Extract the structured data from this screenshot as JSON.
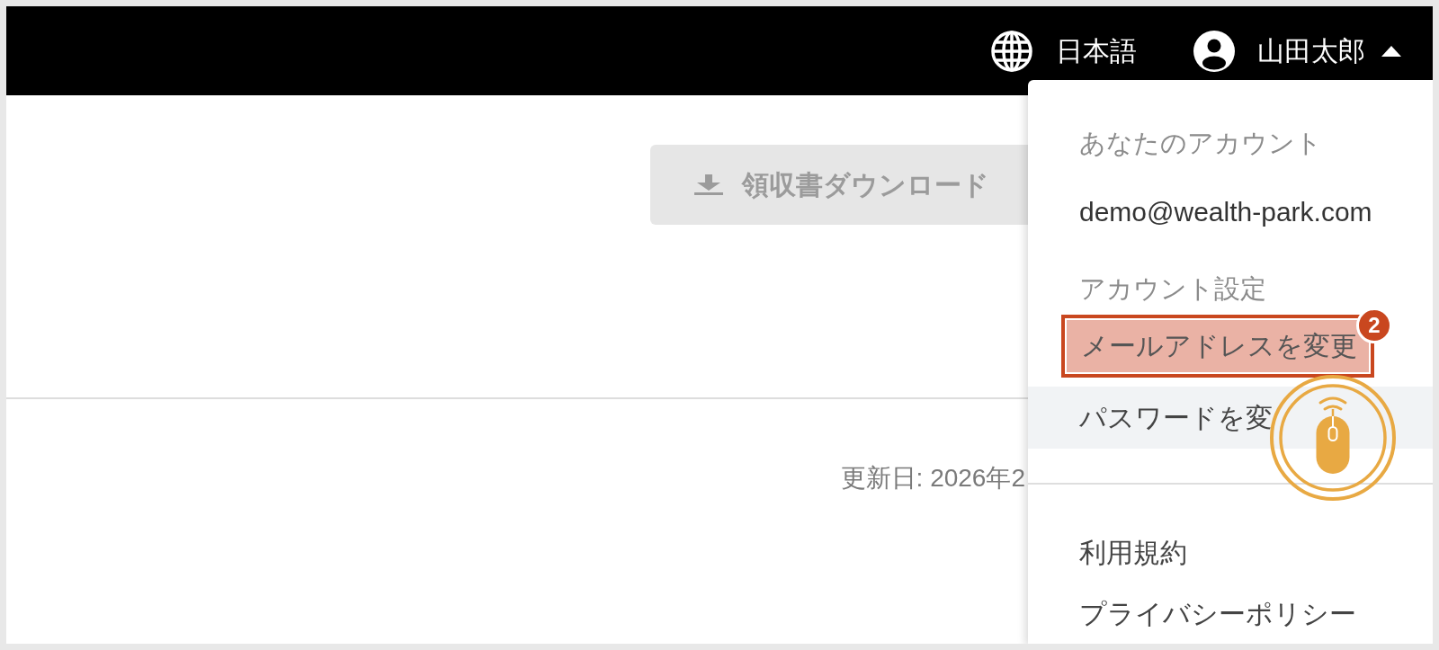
{
  "top_bar": {
    "language": "日本語",
    "user_name": "山田太郎",
    "menu_expanded": true
  },
  "main": {
    "download_button": "領収書ダウンロード",
    "updated_date": "更新日: 2026年2"
  },
  "account_menu": {
    "items": [
      {
        "kind": "heading",
        "label": "あなたのアカウント"
      },
      {
        "kind": "text",
        "label": "demo@wealth-park.com"
      },
      {
        "kind": "heading",
        "label": "アカウント設定"
      },
      {
        "kind": "link",
        "label": "メールアドレスを変更",
        "highlighted": true,
        "hovered": false,
        "badge": "2"
      },
      {
        "kind": "link",
        "label": "パスワードを変",
        "highlighted": false,
        "hovered": true
      }
    ],
    "footer_items": [
      {
        "kind": "link",
        "label": "利用規約",
        "highlighted": false,
        "hovered": false
      },
      {
        "kind": "link",
        "label": "プライバシーポリシー",
        "highlighted": false,
        "hovered": false
      }
    ]
  }
}
